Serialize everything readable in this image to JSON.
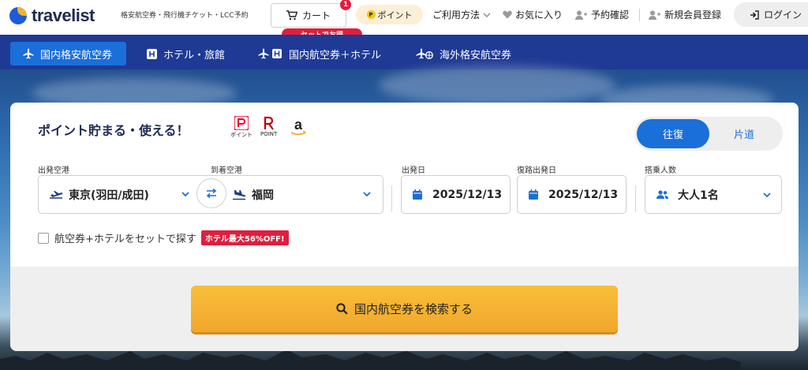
{
  "header": {
    "logo_text": "travelist",
    "tagline": "格安航空券・飛行機チケット・LCC予約",
    "cart_label": "カート",
    "cart_badge": "1",
    "set_tag": "セットでお得",
    "point_label": "ポイント",
    "point_coin": "P",
    "links": {
      "usage": "ご利用方法",
      "favorites": "お気に入り",
      "reservations": "予約確認",
      "signup": "新規会員登録",
      "login": "ログイン"
    }
  },
  "navbar": {
    "tabs": [
      {
        "label": "国内格安航空券",
        "active": true
      },
      {
        "label": "ホテル・旅館",
        "active": false
      },
      {
        "label": "国内航空券＋ホテル",
        "active": false
      },
      {
        "label": "海外格安航空券",
        "active": false
      }
    ]
  },
  "search": {
    "promo_title": "ポイント貯まる・使える！",
    "brand_logos": {
      "paypay_caption": "ポイント",
      "rakuten_caption": "POINT"
    },
    "trip_types": {
      "round_trip": "往復",
      "one_way": "片道",
      "selected": "往復"
    },
    "fields": {
      "departure_label": "出発空港",
      "departure_value": "東京(羽田/成田)",
      "arrival_label": "到着空港",
      "arrival_value": "福岡",
      "depart_date_label": "出発日",
      "depart_date_value": "2025/12/13",
      "return_date_label": "復路出発日",
      "return_date_value": "2025/12/13",
      "passengers_label": "搭乗人数",
      "passengers_value": "大人1名"
    },
    "set_option_label": "航空券+ホテルをセットで探す",
    "set_option_badge": "ホテル最大56%OFF!",
    "set_option_checked": false,
    "search_button": "国内航空券を検索する"
  },
  "colors": {
    "brand_navy": "#1e3a94",
    "accent_blue": "#1b6fd8",
    "search_orange": "#f5b22d",
    "badge_red": "#e01e3c"
  }
}
